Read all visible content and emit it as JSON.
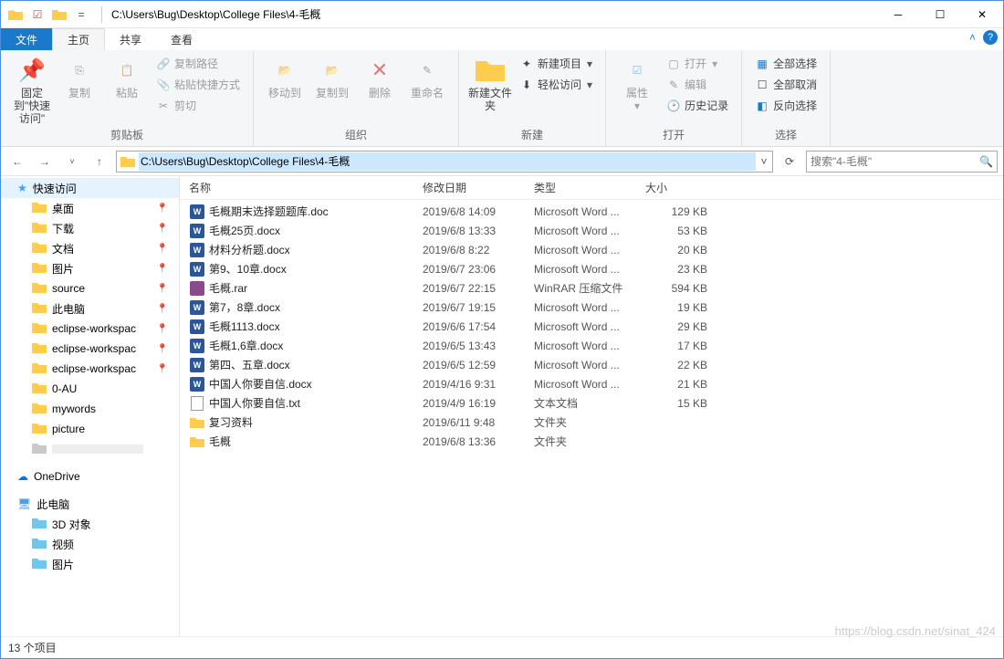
{
  "titlebar": {
    "path": "C:\\Users\\Bug\\Desktop\\College Files\\4-毛概"
  },
  "tabs": {
    "file": "文件",
    "home": "主页",
    "share": "共享",
    "view": "查看"
  },
  "ribbon": {
    "pin": "固定到\"快速访问\"",
    "copy": "复制",
    "paste": "粘贴",
    "copypath": "复制路径",
    "pasteshortcut": "粘贴快捷方式",
    "cut": "剪切",
    "group_clipboard": "剪贴板",
    "moveto": "移动到",
    "copyto": "复制到",
    "delete": "删除",
    "rename": "重命名",
    "group_organize": "组织",
    "newfolder": "新建文件夹",
    "newitem": "新建项目",
    "easyaccess": "轻松访问",
    "group_new": "新建",
    "properties": "属性",
    "open": "打开",
    "edit": "编辑",
    "history": "历史记录",
    "group_open": "打开",
    "selectall": "全部选择",
    "selectnone": "全部取消",
    "invertsel": "反向选择",
    "group_select": "选择"
  },
  "address": {
    "path": "C:\\Users\\Bug\\Desktop\\College Files\\4-毛概",
    "search_placeholder": "搜索\"4-毛概\""
  },
  "sidebar": {
    "quickaccess": "快速访问",
    "items": [
      {
        "label": "桌面",
        "pin": true
      },
      {
        "label": "下载",
        "pin": true
      },
      {
        "label": "文档",
        "pin": true
      },
      {
        "label": "图片",
        "pin": true
      },
      {
        "label": "source",
        "pin": true
      },
      {
        "label": "此电脑",
        "pin": true
      },
      {
        "label": "eclipse-workspac",
        "pin": true
      },
      {
        "label": "eclipse-workspac",
        "pin": true
      },
      {
        "label": "eclipse-workspac",
        "pin": true
      },
      {
        "label": "0-AU",
        "pin": false
      },
      {
        "label": "mywords",
        "pin": false
      },
      {
        "label": "picture",
        "pin": false
      }
    ],
    "onedrive": "OneDrive",
    "thispc": "此电脑",
    "pc_items": [
      {
        "label": "3D 对象"
      },
      {
        "label": "视频"
      },
      {
        "label": "图片"
      }
    ]
  },
  "columns": {
    "name": "名称",
    "date": "修改日期",
    "type": "类型",
    "size": "大小"
  },
  "files": [
    {
      "icon": "word",
      "name": "毛概期末选择题题库.doc",
      "date": "2019/6/8 14:09",
      "type": "Microsoft Word ...",
      "size": "129 KB"
    },
    {
      "icon": "word",
      "name": "毛概25页.docx",
      "date": "2019/6/8 13:33",
      "type": "Microsoft Word ...",
      "size": "53 KB"
    },
    {
      "icon": "word",
      "name": "材料分析题.docx",
      "date": "2019/6/8 8:22",
      "type": "Microsoft Word ...",
      "size": "20 KB"
    },
    {
      "icon": "word",
      "name": "第9、10章.docx",
      "date": "2019/6/7 23:06",
      "type": "Microsoft Word ...",
      "size": "23 KB"
    },
    {
      "icon": "rar",
      "name": "毛概.rar",
      "date": "2019/6/7 22:15",
      "type": "WinRAR 压缩文件",
      "size": "594 KB"
    },
    {
      "icon": "word",
      "name": "第7，8章.docx",
      "date": "2019/6/7 19:15",
      "type": "Microsoft Word ...",
      "size": "19 KB"
    },
    {
      "icon": "word",
      "name": "毛概1113.docx",
      "date": "2019/6/6 17:54",
      "type": "Microsoft Word ...",
      "size": "29 KB"
    },
    {
      "icon": "word",
      "name": "毛概1,6章.docx",
      "date": "2019/6/5 13:43",
      "type": "Microsoft Word ...",
      "size": "17 KB"
    },
    {
      "icon": "word",
      "name": "第四、五章.docx",
      "date": "2019/6/5 12:59",
      "type": "Microsoft Word ...",
      "size": "22 KB"
    },
    {
      "icon": "word",
      "name": "中国人你要自信.docx",
      "date": "2019/4/16 9:31",
      "type": "Microsoft Word ...",
      "size": "21 KB"
    },
    {
      "icon": "txt",
      "name": "中国人你要自信.txt",
      "date": "2019/4/9 16:19",
      "type": "文本文档",
      "size": "15 KB"
    },
    {
      "icon": "folder",
      "name": "复习资料",
      "date": "2019/6/11 9:48",
      "type": "文件夹",
      "size": ""
    },
    {
      "icon": "folder",
      "name": "毛概",
      "date": "2019/6/8 13:36",
      "type": "文件夹",
      "size": ""
    }
  ],
  "status": "13 个项目",
  "watermark": "https://blog.csdn.net/sinat_424"
}
